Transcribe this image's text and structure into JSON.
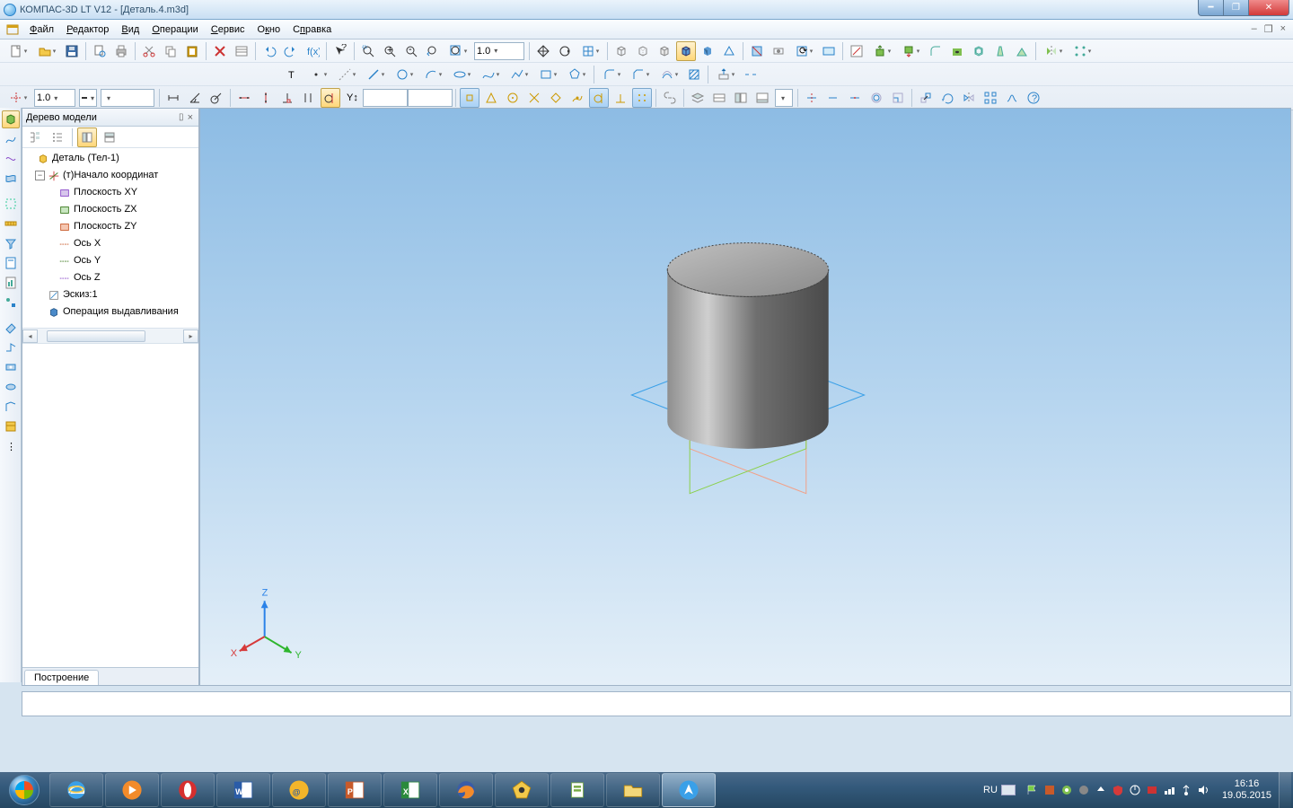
{
  "title": "КОМПАС-3D LT V12 - [Деталь.4.m3d]",
  "menu": {
    "file": {
      "label": "Файл",
      "u": "Ф"
    },
    "editor": {
      "label": "Редактор",
      "u": "Р"
    },
    "view": {
      "label": "Вид",
      "u": "В"
    },
    "ops": {
      "label": "Операции",
      "u": "О"
    },
    "service": {
      "label": "Сервис",
      "u": "С"
    },
    "window": {
      "label": "Окно",
      "u": "к"
    },
    "help": {
      "label": "Справка",
      "u": "п"
    }
  },
  "toolbar": {
    "zoom_value": "1.0",
    "line_weight": "1.0"
  },
  "tree": {
    "title": "Дерево модели",
    "root": "Деталь (Тел-1)",
    "origin": "(т)Начало координат",
    "plane_xy": "Плоскость XY",
    "plane_zx": "Плоскость ZX",
    "plane_zy": "Плоскость ZY",
    "axis_x": "Ось X",
    "axis_y": "Ось Y",
    "axis_z": "Ось Z",
    "sketch": "Эскиз:1",
    "extrude": "Операция выдавливания",
    "tab": "Построение"
  },
  "status": {
    "lang": "RU",
    "time": "16:16",
    "date": "19.05.2015"
  },
  "viewport": {
    "axes": {
      "x": "X",
      "y": "Y",
      "z": "Z"
    }
  }
}
